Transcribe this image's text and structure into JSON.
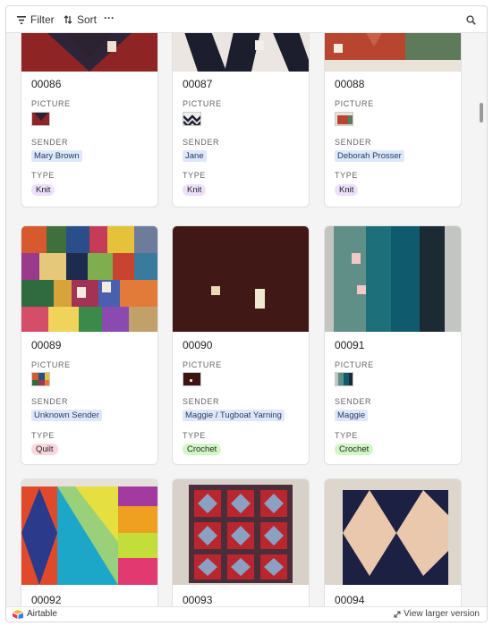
{
  "toolbar": {
    "filter_label": "Filter",
    "sort_label": "Sort",
    "more_label": "···"
  },
  "field_labels": {
    "picture": "PICTURE",
    "sender": "SENDER",
    "type": "TYPE"
  },
  "records": [
    {
      "id": "00086",
      "sender": "Mary Brown",
      "type": "Knit"
    },
    {
      "id": "00087",
      "sender": "Jane",
      "type": "Knit"
    },
    {
      "id": "00088",
      "sender": "Deborah Prosser",
      "type": "Knit"
    },
    {
      "id": "00089",
      "sender": "Unknown Sender",
      "type": "Quilt"
    },
    {
      "id": "00090",
      "sender": "Maggie / Tugboat Yarning",
      "type": "Crochet"
    },
    {
      "id": "00091",
      "sender": "Maggie",
      "type": "Crochet"
    },
    {
      "id": "00092"
    },
    {
      "id": "00093"
    },
    {
      "id": "00094"
    }
  ],
  "footer": {
    "brand": "Airtable",
    "view_larger": "View larger version"
  },
  "colors": {
    "knit_pill": "#ece0fb",
    "quilt_pill": "#fcd6dd",
    "crochet_pill": "#d1f7c4",
    "sender_chip": "#dfe8fb"
  }
}
